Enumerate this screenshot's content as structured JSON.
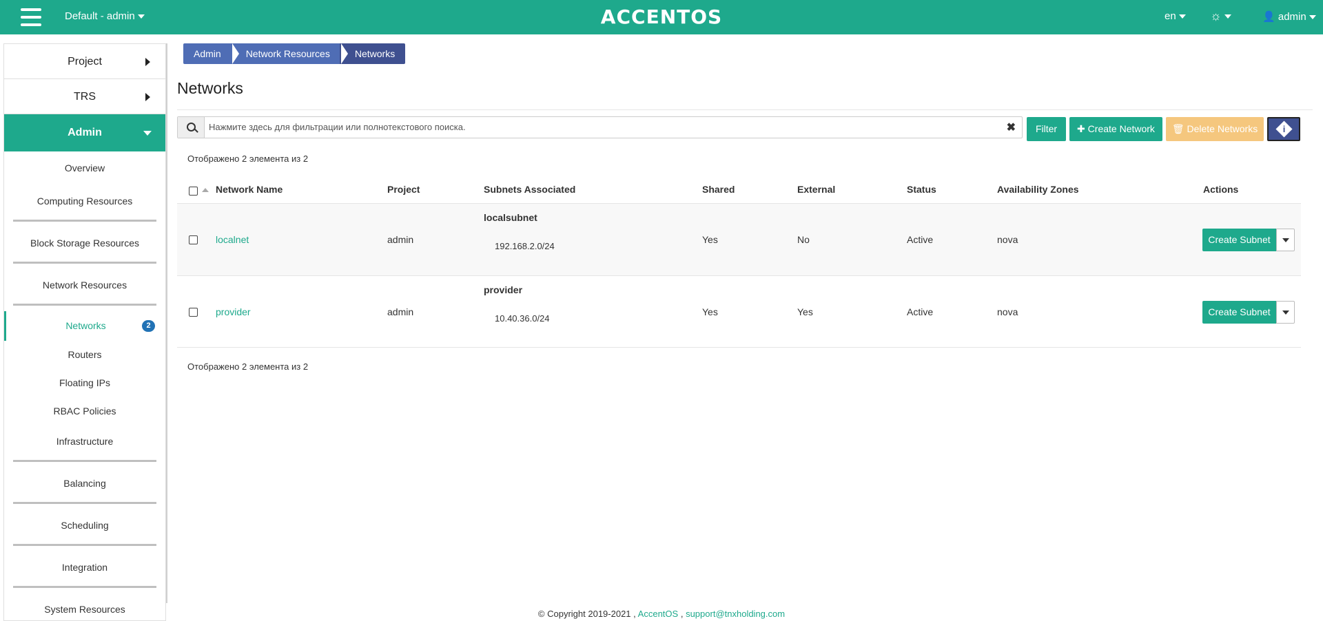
{
  "topbar": {
    "project": "Default - admin",
    "logo": "ACCENTOS",
    "lang": "en",
    "user": "admin"
  },
  "sidebar": {
    "project": "Project",
    "trs": "TRS",
    "admin": "Admin",
    "items": [
      "Overview",
      "Computing Resources",
      "Block Storage Resources",
      "Network Resources",
      "Networks",
      "Routers",
      "Floating IPs",
      "RBAC Policies",
      "Infrastructure",
      "Balancing",
      "Scheduling",
      "Integration",
      "System Resources"
    ],
    "networks_badge": "2"
  },
  "breadcrumb": [
    "Admin",
    "Network Resources",
    "Networks"
  ],
  "page_title": "Networks",
  "toolbar": {
    "search_placeholder": "Нажмите здесь для фильтрации или полнотекстового поиска.",
    "filter": "Filter",
    "create": "Create Network",
    "delete": "Delete Networks"
  },
  "count_text": "Отображено 2 элемента из 2",
  "table": {
    "headers": [
      "Network Name",
      "Project",
      "Subnets Associated",
      "Shared",
      "External",
      "Status",
      "Availability Zones",
      "Actions"
    ],
    "rows": [
      {
        "name": "localnet",
        "project": "admin",
        "subnet_name": "localsubnet",
        "subnet_cidr": "192.168.2.0/24",
        "shared": "Yes",
        "external": "No",
        "status": "Active",
        "az": "nova",
        "action": "Create Subnet"
      },
      {
        "name": "provider",
        "project": "admin",
        "subnet_name": "provider",
        "subnet_cidr": "10.40.36.0/24",
        "shared": "Yes",
        "external": "Yes",
        "status": "Active",
        "az": "nova",
        "action": "Create Subnet"
      }
    ]
  },
  "footer": {
    "copyright": "© Copyright 2019-2021 ,",
    "brand": "AccentOS",
    "sep": ",",
    "email": "support@tnxholding.com"
  }
}
